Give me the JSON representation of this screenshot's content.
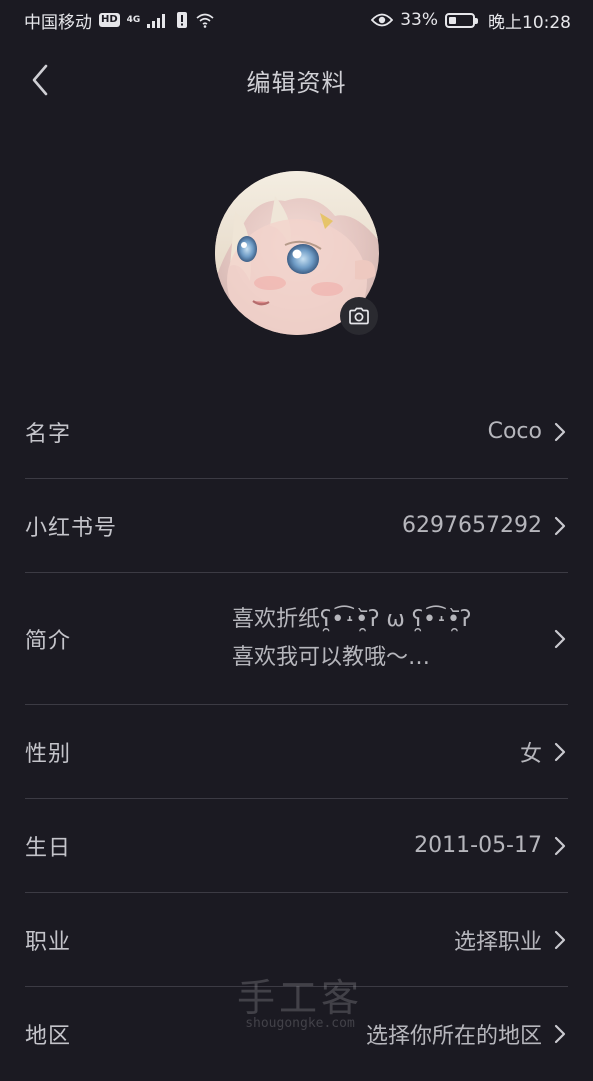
{
  "status_bar": {
    "carrier": "中国移动",
    "hd_badge": "HD",
    "network_type": "4G",
    "battery_percent_text": "33%",
    "battery_level": 0.33,
    "time": "晚上10:28"
  },
  "header": {
    "title": "编辑资料"
  },
  "profile": {
    "rows": [
      {
        "label": "名字",
        "value": "Coco"
      },
      {
        "label": "小红书号",
        "value": "6297657292"
      },
      {
        "label": "简介",
        "value_line1": "喜欢折纸ʕ̯•͡˔•̯᷅ʔ ω ʕ̯•͡˔•̯᷅ʔ",
        "value_line2": "喜欢我可以教哦～…"
      },
      {
        "label": "性别",
        "value": "女"
      },
      {
        "label": "生日",
        "value": "2011-05-17"
      },
      {
        "label": "职业",
        "value": "选择职业"
      },
      {
        "label": "地区",
        "value": "选择你所在的地区"
      }
    ]
  },
  "watermark": {
    "text": "手工客",
    "site": "shougongke.com"
  },
  "colors": {
    "background": "#1b1a22",
    "divider": "#3c3b44",
    "text_primary": "#c4c4ca",
    "text_secondary": "#b6b6bc"
  }
}
